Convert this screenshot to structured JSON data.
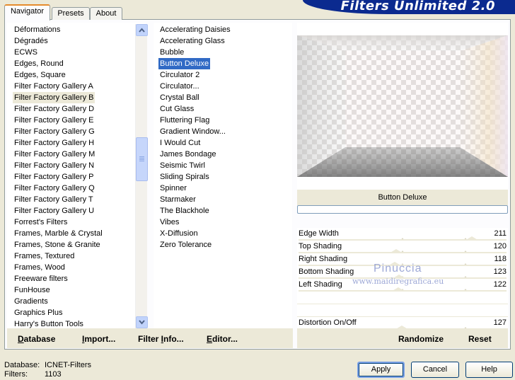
{
  "window": {
    "title": "Filters Unlimited 2.0"
  },
  "tabs": [
    {
      "label": "Navigator",
      "active": true
    },
    {
      "label": "Presets",
      "active": false
    },
    {
      "label": "About",
      "active": false
    }
  ],
  "categories": {
    "items": [
      "Déformations",
      "Dégradés",
      "ECWS",
      "Edges, Round",
      "Edges, Square",
      "Filter Factory Gallery A",
      "Filter Factory Gallery B",
      "Filter Factory Gallery D",
      "Filter Factory Gallery E",
      "Filter Factory Gallery G",
      "Filter Factory Gallery H",
      "Filter Factory Gallery M",
      "Filter Factory Gallery N",
      "Filter Factory Gallery P",
      "Filter Factory Gallery Q",
      "Filter Factory Gallery T",
      "Filter Factory Gallery U",
      "Forrest's Filters",
      "Frames, Marble & Crystal",
      "Frames, Stone & Granite",
      "Frames, Textured",
      "Frames, Wood",
      "Freeware filters",
      "FunHouse",
      "Gradients",
      "Graphics Plus",
      "Harry's Button Tools"
    ],
    "selected": "Filter Factory Gallery B"
  },
  "filters": {
    "items": [
      "Accelerating Daisies",
      "Accelerating Glass",
      "Bubble",
      "Button Deluxe",
      "Circulator 2",
      "Circulator...",
      "Crystal Ball",
      "Cut Glass",
      "Fluttering Flag",
      "Gradient Window...",
      "I Would Cut",
      "James Bondage",
      "Seismic Twirl",
      "Sliding Spirals",
      "Spinner",
      "Starmaker",
      "The Blackhole",
      "Vibes",
      "X-Diffusion",
      "Zero Tolerance"
    ],
    "selected": "Button Deluxe"
  },
  "left_buttons": {
    "database": {
      "label": "Database",
      "underline": "D",
      "rest": "atabase"
    },
    "import": {
      "label": "Import...",
      "underline": "I",
      "rest": "mport..."
    },
    "filter_info": {
      "label": "Filter Info...",
      "prefix": "Filter ",
      "underline": "I",
      "rest": "nfo..."
    },
    "editor": {
      "label": "Editor...",
      "underline": "E",
      "rest": "ditor..."
    }
  },
  "preview": {
    "filter_name": "Button Deluxe",
    "progress": 0
  },
  "parameters": [
    {
      "name": "Edge Width",
      "value": "211",
      "max": 255
    },
    {
      "name": "Top Shading",
      "value": "120",
      "max": 255
    },
    {
      "name": "Right Shading",
      "value": "118",
      "max": 255
    },
    {
      "name": "Bottom Shading",
      "value": "123",
      "max": 255
    },
    {
      "name": "Left Shading",
      "value": "122",
      "max": 255
    },
    {
      "name": "Distortion On/Off",
      "value": "127",
      "max": 255
    }
  ],
  "watermark": {
    "name": "Pinuccia",
    "site": "www.maidiregrafica.eu"
  },
  "right_buttons": {
    "randomize": "Randomize",
    "reset": "Reset"
  },
  "status": {
    "database_key": "Database:",
    "database_value": "ICNET-Filters",
    "filters_key": "Filters:",
    "filters_value": "1103"
  },
  "dialog_buttons": {
    "apply": "Apply",
    "cancel": "Cancel",
    "help": "Help"
  },
  "colors": {
    "accent_selection": "#316ac5",
    "banner": "#0b2a8f",
    "tab_highlight": "#e68b2c"
  }
}
